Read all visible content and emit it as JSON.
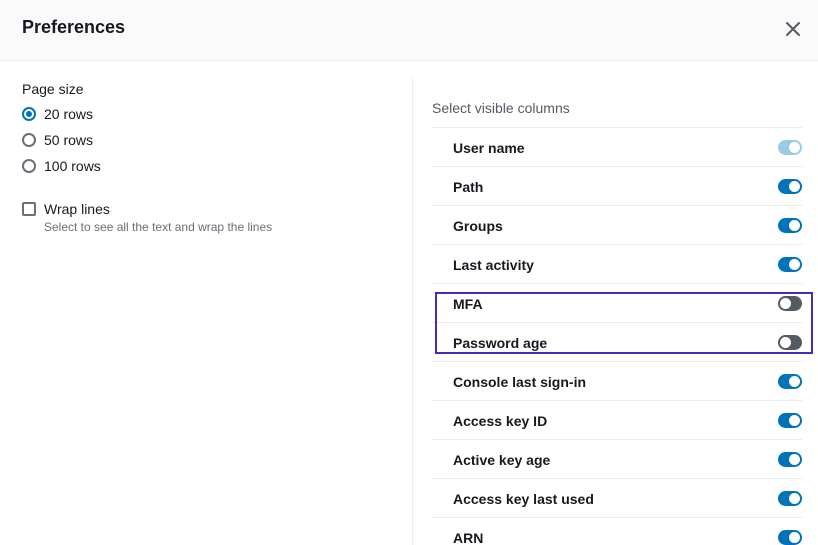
{
  "dialog": {
    "title": "Preferences",
    "close_icon": "close-icon"
  },
  "page_size": {
    "label": "Page size",
    "options": [
      {
        "label": "20 rows",
        "checked": true
      },
      {
        "label": "50 rows",
        "checked": false
      },
      {
        "label": "100 rows",
        "checked": false
      }
    ]
  },
  "wrap_lines": {
    "label": "Wrap lines",
    "description": "Select to see all the text and wrap the lines",
    "checked": false
  },
  "visible_columns": {
    "title": "Select visible columns",
    "items": [
      {
        "label": "User name",
        "enabled": true,
        "disabled": true
      },
      {
        "label": "Path",
        "enabled": true,
        "disabled": false
      },
      {
        "label": "Groups",
        "enabled": true,
        "disabled": false
      },
      {
        "label": "Last activity",
        "enabled": true,
        "disabled": false
      },
      {
        "label": "MFA",
        "enabled": false,
        "disabled": false
      },
      {
        "label": "Password age",
        "enabled": false,
        "disabled": false
      },
      {
        "label": "Console last sign-in",
        "enabled": true,
        "disabled": false
      },
      {
        "label": "Access key ID",
        "enabled": true,
        "disabled": false
      },
      {
        "label": "Active key age",
        "enabled": true,
        "disabled": false
      },
      {
        "label": "Access key last used",
        "enabled": true,
        "disabled": false
      },
      {
        "label": "ARN",
        "enabled": true,
        "disabled": false
      }
    ]
  },
  "colors": {
    "accent": "#0073bb",
    "toggle_off": "#545b64",
    "toggle_disabled": "#99cbe4",
    "highlight_border": "#4b2ab8"
  }
}
